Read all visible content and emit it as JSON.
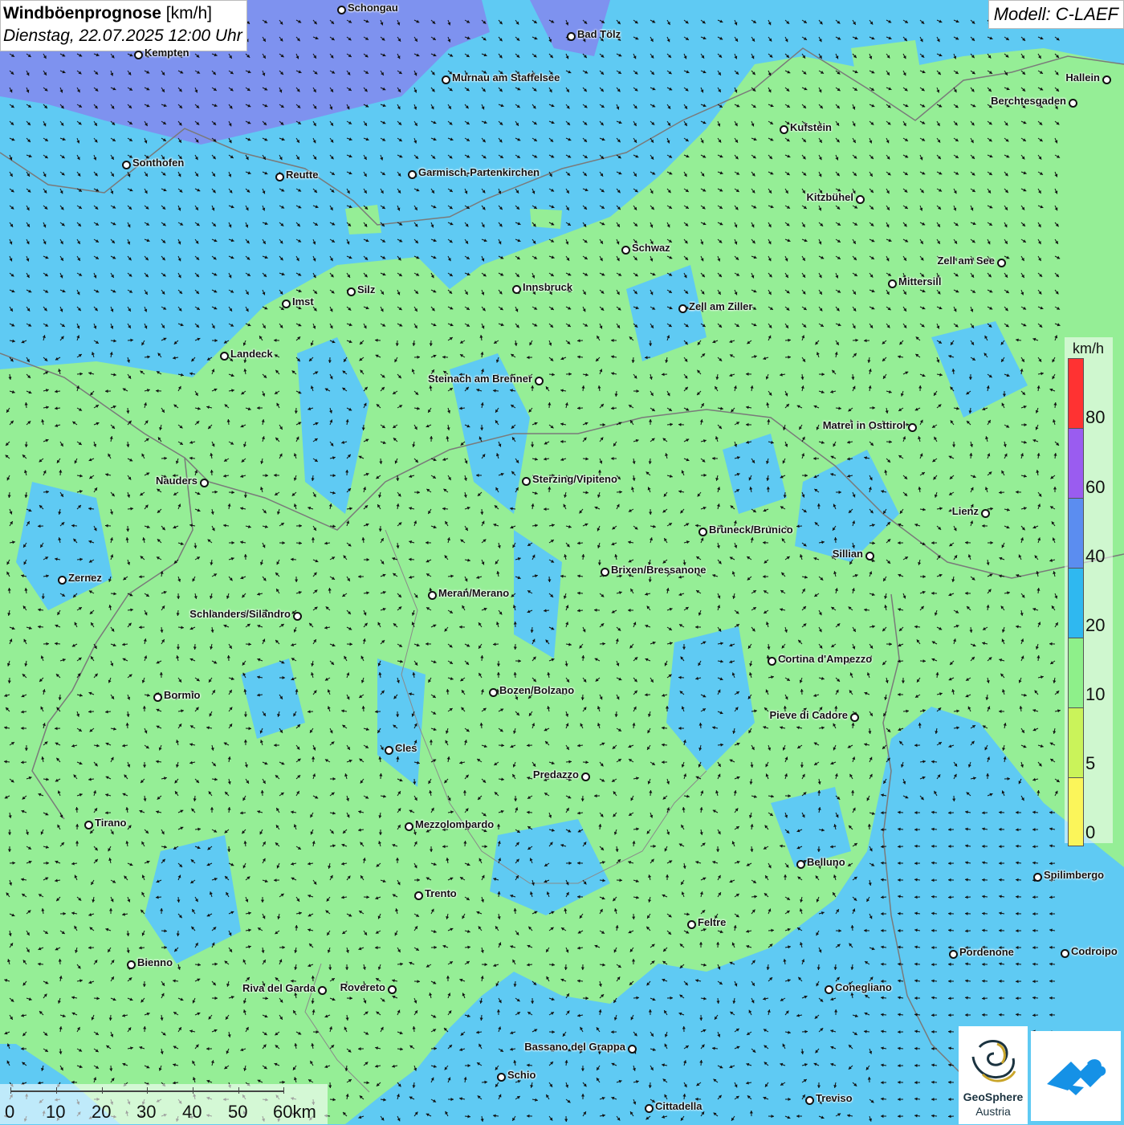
{
  "header": {
    "title_bold": "Windböenprognose",
    "title_unit": " [km/h]",
    "date": "Dienstag, 22.07.2025 12:00 Uhr",
    "model": "Modell: C-LAEF"
  },
  "legend": {
    "unit": "km/h",
    "labels": [
      "80",
      "60",
      "40",
      "20",
      "10",
      "5",
      "0"
    ],
    "colors": [
      "#ff3232",
      "#9a5cf0",
      "#5b8df0",
      "#2fb8f0",
      "#8ef08a",
      "#caf35a",
      "#fbf55a"
    ]
  },
  "scale": {
    "labels": [
      "0",
      "10",
      "20",
      "30",
      "40",
      "50",
      "60km"
    ]
  },
  "logos": {
    "geosphere_line1": "GeoSphere",
    "geosphere_line2": "Austria"
  },
  "colors": {
    "calm_green": "#93ef94",
    "blue_zone": "#5cc9f2",
    "purple_zone": "#7b8ef0"
  },
  "cities": [
    {
      "name": "Schongau"
    },
    {
      "name": "Bad Tölz"
    },
    {
      "name": "Kempten"
    },
    {
      "name": "Murnau am Staffelsee"
    },
    {
      "name": "Hallein"
    },
    {
      "name": "Berchtesgaden"
    },
    {
      "name": "Kufstein"
    },
    {
      "name": "Sonthofen"
    },
    {
      "name": "Reutte"
    },
    {
      "name": "Garmisch-Partenkirchen"
    },
    {
      "name": "Kitzbühel"
    },
    {
      "name": "Schwaz"
    },
    {
      "name": "Zell am See"
    },
    {
      "name": "Mittersill"
    },
    {
      "name": "Imst"
    },
    {
      "name": "Silz"
    },
    {
      "name": "Innsbruck"
    },
    {
      "name": "Zell am Ziller"
    },
    {
      "name": "Landeck"
    },
    {
      "name": "Steinach am Brenner"
    },
    {
      "name": "Matrei in Osttirol"
    },
    {
      "name": "Nauders"
    },
    {
      "name": "Sterzing/Vipiteno"
    },
    {
      "name": "Lienz"
    },
    {
      "name": "Bruneck/Brunico"
    },
    {
      "name": "Sillian"
    },
    {
      "name": "Zernez"
    },
    {
      "name": "Brixen/Bressanone"
    },
    {
      "name": "Meran/Merano"
    },
    {
      "name": "Schlanders/Silandro"
    },
    {
      "name": "Cortina d'Ampezzo"
    },
    {
      "name": "Bozen/Bolzano"
    },
    {
      "name": "Bormio"
    },
    {
      "name": "Pieve di Cadore"
    },
    {
      "name": "Cles"
    },
    {
      "name": "Predazzo"
    },
    {
      "name": "Tirano"
    },
    {
      "name": "Mezzolombardo"
    },
    {
      "name": "Belluno"
    },
    {
      "name": "Spilimbergo"
    },
    {
      "name": "Trento"
    },
    {
      "name": "Feltre"
    },
    {
      "name": "Pordenone"
    },
    {
      "name": "Codroipo"
    },
    {
      "name": "Bienno"
    },
    {
      "name": "Riva del Garda"
    },
    {
      "name": "Rovereto"
    },
    {
      "name": "Conegliano"
    },
    {
      "name": "Bassano del Grappa"
    },
    {
      "name": "Schio"
    },
    {
      "name": "Treviso"
    },
    {
      "name": "Cittadella"
    }
  ]
}
